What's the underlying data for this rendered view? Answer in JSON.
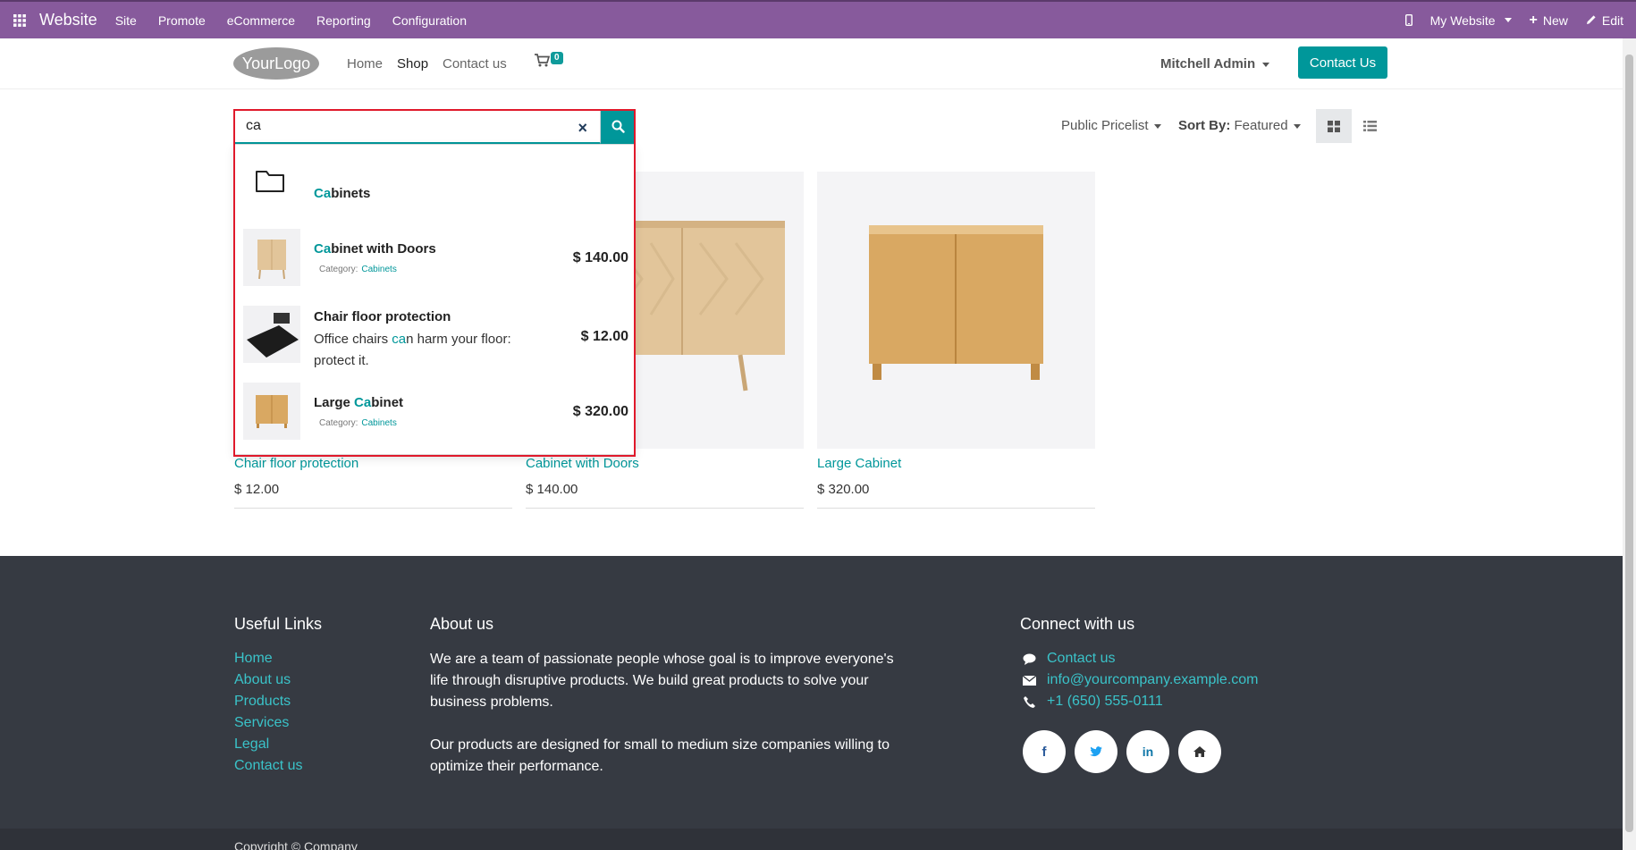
{
  "admin_bar": {
    "app_name": "Website",
    "menu": [
      "Site",
      "Promote",
      "eCommerce",
      "Reporting",
      "Configuration"
    ],
    "website_selector": "My Website",
    "new_label": "New",
    "edit_label": "Edit"
  },
  "header": {
    "logo_text": "YourLogo",
    "nav": [
      "Home",
      "Shop",
      "Contact us"
    ],
    "cart_count": "0",
    "user": "Mitchell Admin",
    "contact_button": "Contact Us"
  },
  "toolbar": {
    "pricelist": "Public Pricelist",
    "sort_label": "Sort By:",
    "sort_value": "Featured"
  },
  "search": {
    "value": "ca",
    "clear": "×"
  },
  "suggestions": {
    "category": {
      "highlight": "Ca",
      "rest": "binets"
    },
    "items": [
      {
        "title_hl": "Ca",
        "title_rest": "binet with Doors",
        "category_label": "Category:",
        "category": "Cabinets",
        "price": "$ 140.00"
      },
      {
        "title": "Chair floor protection",
        "desc_pre": "Office chairs ",
        "desc_hl": "ca",
        "desc_post": "n harm your floor: protect it.",
        "price": "$ 12.00"
      },
      {
        "title_pre": "Large ",
        "title_hl": "Ca",
        "title_rest": "binet",
        "category_label": "Category:",
        "category": "Cabinets",
        "price": "$ 320.00"
      }
    ]
  },
  "products": [
    {
      "name": "Chair floor protection",
      "price": "$ 12.00"
    },
    {
      "name": "Cabinet with Doors",
      "price": "$ 140.00"
    },
    {
      "name": "Large Cabinet",
      "price": "$ 320.00"
    }
  ],
  "footer": {
    "useful_links_title": "Useful Links",
    "useful_links": [
      "Home",
      "About us",
      "Products",
      "Services",
      "Legal",
      "Contact us"
    ],
    "about_title": "About us",
    "about_p1": "We are a team of passionate people whose goal is to improve everyone's life through disruptive products. We build great products to solve your business problems.",
    "about_p2": "Our products are designed for small to medium size companies willing to optimize their performance.",
    "connect_title": "Connect with us",
    "connect": [
      "Contact us",
      "info@yourcompany.example.com",
      "+1 (650) 555-0111"
    ],
    "copyright": "Copyright © Company"
  },
  "colors": {
    "admin_bar": "#875a9c",
    "accent": "#00979a",
    "footer_bg": "#363a42",
    "highlight_frame": "#e0192b"
  }
}
